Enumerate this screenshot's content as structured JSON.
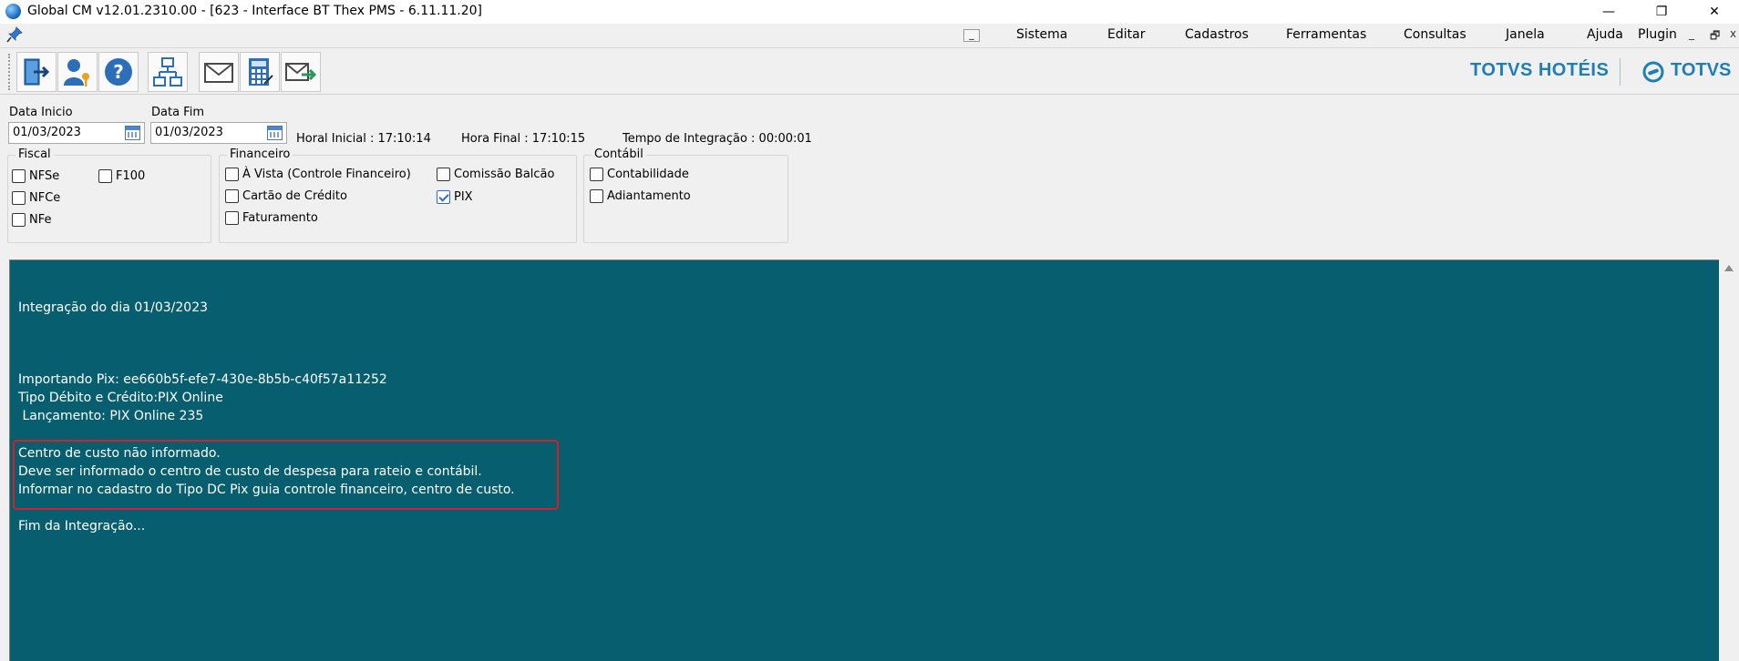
{
  "window": {
    "title": "Global CM v12.01.2310.00 - [623 - Interface BT Thex PMS - 6.11.11.20]",
    "minimize": "—",
    "restore": "❐",
    "close": "✕"
  },
  "menu": {
    "min_box": "_",
    "items": [
      {
        "label": "Sistema"
      },
      {
        "label": "Editar"
      },
      {
        "label": "Cadastros"
      },
      {
        "label": "Ferramentas"
      },
      {
        "label": "Consultas"
      },
      {
        "label": "Janela"
      },
      {
        "label": "Ajuda"
      },
      {
        "label": "Plugin"
      }
    ],
    "mdi_min": "_",
    "mdi_restore": "🗗",
    "mdi_close": "x"
  },
  "toolbar": {
    "icons": [
      "exit-door-icon",
      "user-key-icon",
      "help-icon",
      "network-icon",
      "envelope-icon",
      "calculator-icon",
      "send-mail-icon"
    ]
  },
  "brand": {
    "left": "TOTVS HOTÉIS",
    "right": "TOTVS",
    "color": "#1f7fb5"
  },
  "filters": {
    "data_inicio_label": "Data Inicio",
    "data_inicio_value": "01/03/2023",
    "data_fim_label": "Data Fim",
    "data_fim_value": "01/03/2023",
    "hora_inicial": "Horal Inicial : 17:10:14",
    "hora_final": "Hora Final : 17:10:15",
    "tempo_integracao": "Tempo de Integração :  00:00:01"
  },
  "groups": {
    "fiscal": {
      "title": "Fiscal",
      "items": [
        {
          "label": "NFSe",
          "checked": false
        },
        {
          "label": "F100",
          "checked": false
        },
        {
          "label": "NFCe",
          "checked": false
        },
        {
          "label": "NFe",
          "checked": false
        }
      ]
    },
    "financeiro": {
      "title": "Financeiro",
      "items": [
        {
          "label": "À Vista (Controle Financeiro)",
          "checked": false
        },
        {
          "label": "Comissão Balcão",
          "checked": false
        },
        {
          "label": "Cartão de Crédito",
          "checked": false
        },
        {
          "label": "PIX",
          "checked": true
        },
        {
          "label": "Faturamento",
          "checked": false
        }
      ]
    },
    "contabil": {
      "title": "Contábil",
      "items": [
        {
          "label": "Contabilidade",
          "checked": false
        },
        {
          "label": "Adiantamento",
          "checked": false
        }
      ]
    }
  },
  "log": {
    "background": "#075e6e",
    "highlight_color": "#d0202a",
    "lines": [
      "Integração do dia 01/03/2023",
      "Importando Pix: ee660b5f-efe7-430e-8b5b-c40f57a11252",
      "Tipo Débito e Crédito:PIX Online",
      " Lançamento: PIX Online 235",
      "Centro de custo não informado.",
      "Deve ser informado o centro de custo de despesa para rateio e contábil.",
      "Informar no cadastro do Tipo DC Pix guia controle financeiro, centro de custo.",
      "Fim da Integração..."
    ]
  }
}
